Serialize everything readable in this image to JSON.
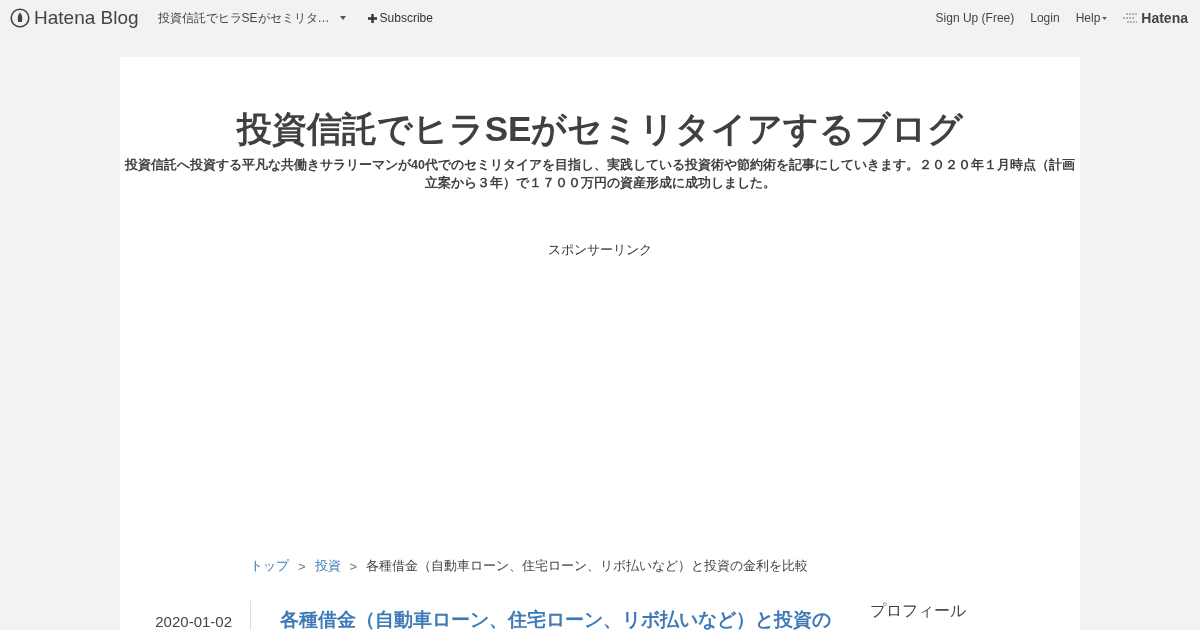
{
  "navbar": {
    "logo": "Hatena Blog",
    "blog_menu": "投資信託でヒラSEがセミリタ…",
    "subscribe": "Subscribe",
    "links": [
      "Sign Up (Free)",
      "Login"
    ],
    "help": "Help",
    "brand": "Hatena"
  },
  "blog": {
    "title": "投資信託でヒラSEがセミリタイアするブログ",
    "description": "投資信託へ投資する平凡な共働きサラリーマンが40代でのセミリタイアを目指し、実践している投資術や節約術を記事にしていきます。２０２０年１月時点（計画立案から３年）で１７００万円の資産形成に成功しました。"
  },
  "sponsor": "スポンサーリンク",
  "breadcrumb": [
    {
      "label": "トップ",
      "kind": "link"
    },
    {
      "label": "投資",
      "kind": "link"
    },
    {
      "label": "各種借金（自動車ローン、住宅ローン、リボ払いなど）と投資の金利を比較",
      "kind": "current"
    }
  ],
  "breadcrumb_separator": ">",
  "entry": {
    "date": "2020-01-02",
    "title": "各種借金（自動車ローン、住宅ローン、リボ払いなど）と投資の"
  },
  "sidebar": {
    "heading": "プロフィール"
  }
}
